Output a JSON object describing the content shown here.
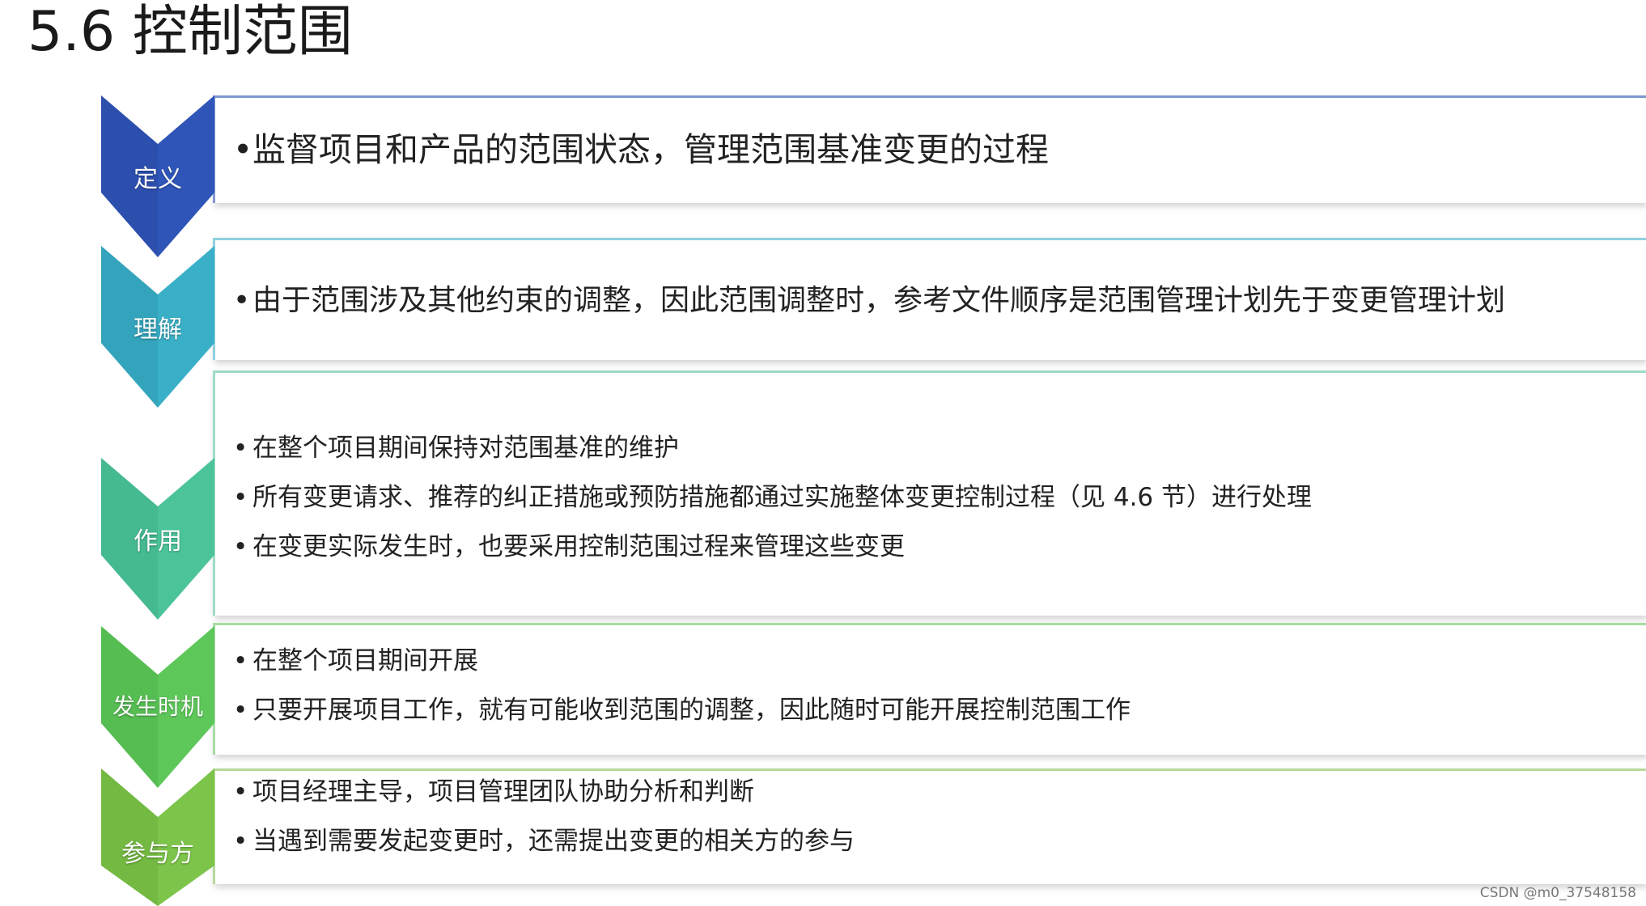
{
  "title": "5.6 控制范围",
  "colors": {
    "row1": "#2f55b8",
    "row2": "#3ab0c8",
    "row3": "#4cc49a",
    "row4": "#5ec75a",
    "row5": "#7cc44a"
  },
  "rows": [
    {
      "label": "定义",
      "bullets": [
        "监督项目和产品的范围状态，管理范围基准变更的过程"
      ]
    },
    {
      "label": "理解",
      "bullets": [
        "由于范围涉及其他约束的调整，因此范围调整时，参考文件顺序是范围管理计划先于变更管理计划"
      ]
    },
    {
      "label": "作用",
      "bullets": [
        "在整个项目期间保持对范围基准的维护",
        "所有变更请求、推荐的纠正措施或预防措施都通过实施整体变更控制过程（见 4.6 节）进行处理",
        "在变更实际发生时，也要采用控制范围过程来管理这些变更"
      ]
    },
    {
      "label": "发生时机",
      "bullets": [
        "在整个项目期间开展",
        "只要开展项目工作，就有可能收到范围的调整，因此随时可能开展控制范围工作"
      ]
    },
    {
      "label": "参与方",
      "bullets": [
        "项目经理主导，项目管理团队协助分析和判断",
        "当遇到需要发起变更时，还需提出变更的相关方的参与"
      ]
    }
  ],
  "watermark": "CSDN @m0_37548158"
}
